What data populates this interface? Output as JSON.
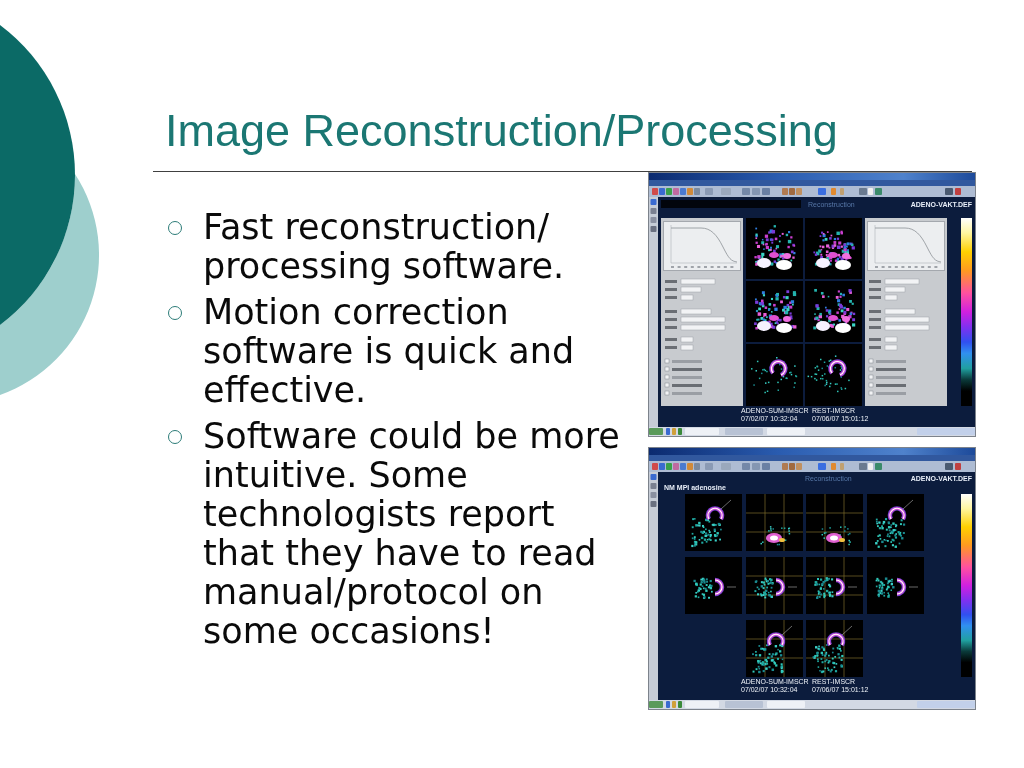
{
  "slide": {
    "title": "Image Reconstruction/Processing"
  },
  "bullets": [
    "Fast reconstruction/processing software.",
    "Motion correction software is quick and effective.",
    "Software could be more intuitive. Some technologists report that they have to read manual/protocol on some occasions!"
  ],
  "screenshots": [
    {
      "kind": "reconstruction",
      "view_title": "Reconstruction",
      "protocol": "ADENO-VAKT.DEF",
      "datasets": [
        {
          "name": "ADENO-SUM-IMSCR",
          "datetime": "07/02/07 10:32:04"
        },
        {
          "name": "REST-IMSCR",
          "datetime": "07/06/07 15:01:12"
        }
      ]
    },
    {
      "kind": "review",
      "view_title": "Reconstruction",
      "protocol": "ADENO-VAKT.DEF",
      "study": "NM MPI adenosine",
      "datasets": [
        {
          "name": "ADENO-SUM-IMSCR",
          "datetime": "07/02/07 10:32:04"
        },
        {
          "name": "REST-IMSCR",
          "datetime": "07/06/07 15:01:12"
        }
      ]
    }
  ]
}
